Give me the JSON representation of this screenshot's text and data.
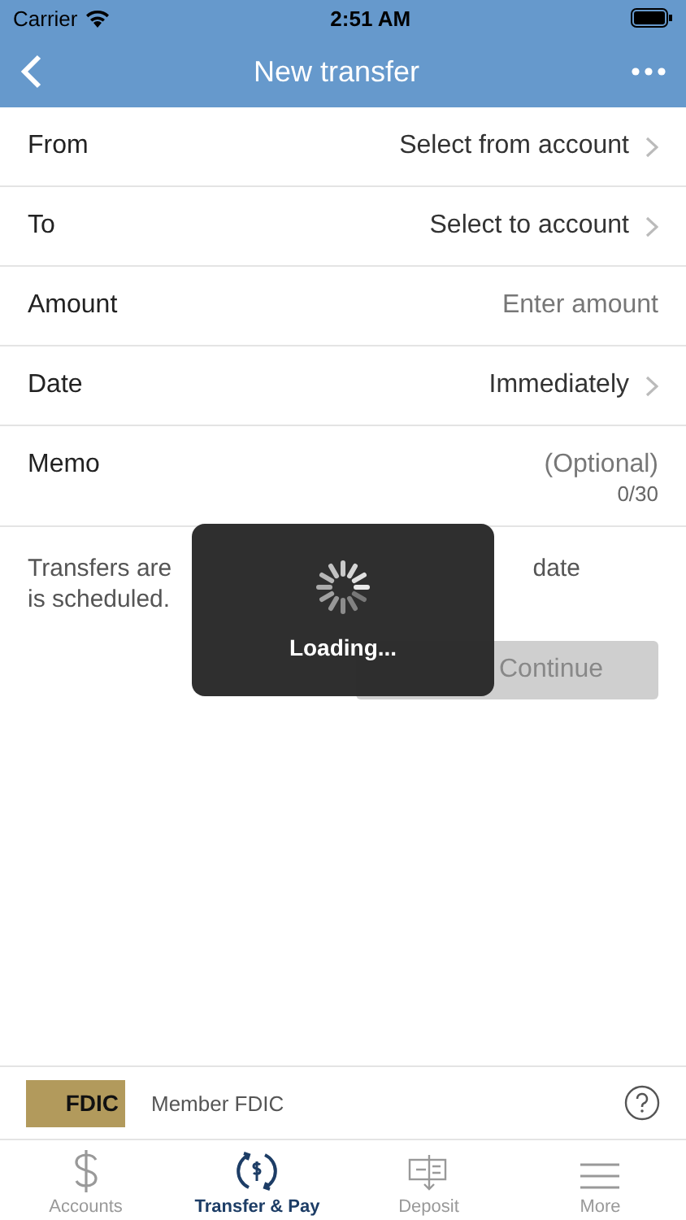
{
  "status_bar": {
    "carrier": "Carrier",
    "time": "2:51 AM"
  },
  "nav": {
    "title": "New transfer"
  },
  "fields": [
    {
      "kind": "select",
      "label": "From",
      "placeholder": "Select from account"
    },
    {
      "kind": "select",
      "label": "To",
      "placeholder": "Select to account"
    },
    {
      "kind": "input",
      "label": "Amount",
      "placeholder": "Enter amount"
    },
    {
      "kind": "select",
      "label": "Date",
      "value": "Immediately"
    },
    {
      "kind": "memo",
      "label": "Memo",
      "placeholder": "(Optional)",
      "counter": "0/30"
    }
  ],
  "note": [
    "Transfers are",
    "date",
    "is scheduled."
  ],
  "continue_button": {
    "label": "Continue",
    "disabled": true
  },
  "loading": {
    "label": "Loading..."
  },
  "footer": {
    "logo": "FDIC",
    "text": "Member FDIC"
  },
  "tabs": [
    {
      "kind": "dollar",
      "label": "Accounts",
      "selected": false
    },
    {
      "kind": "transfer",
      "label": "Transfer & Pay",
      "selected": true
    },
    {
      "kind": "deposit",
      "label": "Deposit",
      "selected": false
    },
    {
      "kind": "more",
      "label": "More",
      "selected": false
    }
  ]
}
